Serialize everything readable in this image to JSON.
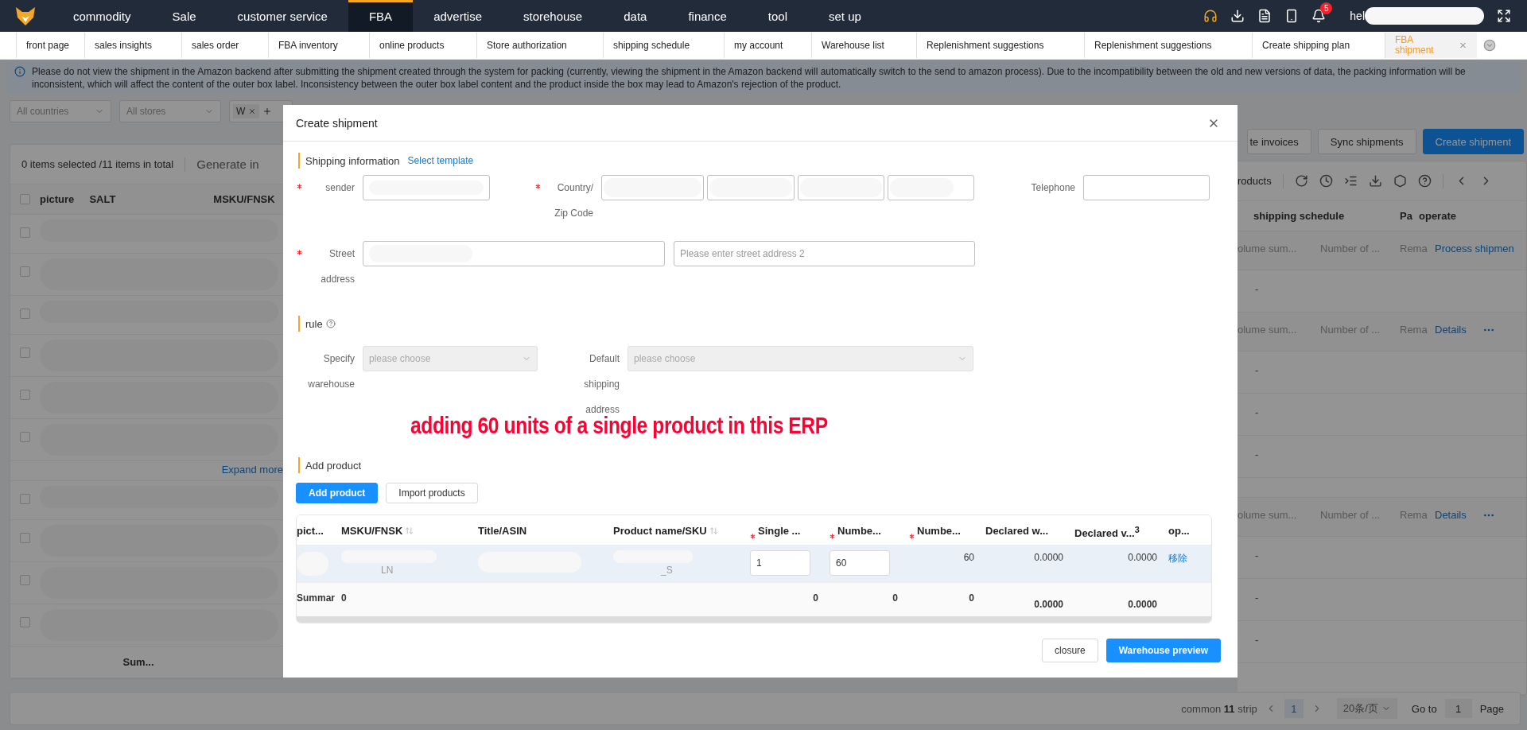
{
  "nav": {
    "menu": [
      {
        "label": "commodity",
        "selected": false
      },
      {
        "label": "Sale",
        "selected": false
      },
      {
        "label": "customer service",
        "selected": false
      },
      {
        "label": "FBA",
        "selected": true
      },
      {
        "label": "advertise",
        "selected": false
      },
      {
        "label": "storehouse",
        "selected": false
      },
      {
        "label": "data",
        "selected": false
      },
      {
        "label": "finance",
        "selected": false
      },
      {
        "label": "tool",
        "selected": false
      },
      {
        "label": "set up",
        "selected": false
      }
    ],
    "notifications": "5",
    "user": "hel"
  },
  "tabs": [
    {
      "label": "front page",
      "selected": false
    },
    {
      "label": "sales insights",
      "selected": false
    },
    {
      "label": "sales order",
      "selected": false
    },
    {
      "label": "FBA inventory",
      "selected": false
    },
    {
      "label": "online products",
      "selected": false
    },
    {
      "label": "Store authorization",
      "selected": false
    },
    {
      "label": "shipping schedule",
      "selected": false
    },
    {
      "label": "my account",
      "selected": false
    },
    {
      "label": "Warehouse list",
      "selected": false
    },
    {
      "label": "Replenishment suggestions",
      "selected": false
    },
    {
      "label": "Replenishment suggestions",
      "selected": false
    },
    {
      "label": "Create shipping plan",
      "selected": false
    },
    {
      "label": "FBA shipment",
      "selected": true
    }
  ],
  "notice": "Please do not view the shipment in the Amazon backend after submitting the shipment created through the system for packing (currently, viewing the shipment in the Amazon backend will automatically switch to the send to amazon process). Due to the incompatibility between the old and new versions of data, the packing information will be inconsistent, which will affect the content of the outer box label. Inconsistency between the outer box label content and the product inside the box may lead to Amazon's rejection of the product.",
  "filters": {
    "country": "All countries",
    "store": "All stores",
    "tag": "W"
  },
  "actions": [
    {
      "label": "te invoices",
      "kind": "default"
    },
    {
      "label": "Sync shipments",
      "kind": "default"
    },
    {
      "label": "Create shipment",
      "kind": "primary"
    }
  ],
  "list": {
    "all_checked": false,
    "selection": "0 items selected /11 items in total",
    "generate": "Generate in",
    "products": "roducts",
    "columns_left": [
      "picture",
      "SALT",
      "MSKU/FNSK"
    ],
    "columns_right": [
      "shipping schedule",
      "Pa",
      "operate"
    ],
    "rows": [
      {
        "kind": "parent",
        "checked": false,
        "volume": "olume sum...",
        "count": "Number of ...",
        "remark": "Rema",
        "action": "Process shipmen",
        "more": false
      },
      {
        "kind": "child",
        "checked": false,
        "value": "-"
      },
      {
        "kind": "parent",
        "checked": false,
        "volume": "olume sum...",
        "count": "Number of ...",
        "remark": "Rema",
        "action": "Details",
        "more": true
      },
      {
        "kind": "child",
        "checked": false,
        "value": "-"
      },
      {
        "kind": "child",
        "checked": false,
        "value": "-"
      },
      {
        "kind": "child",
        "checked": false,
        "value": "-"
      },
      {
        "kind": "expand",
        "label": "Expand more"
      },
      {
        "kind": "parent",
        "checked": false,
        "volume": "olume sum...",
        "count": "Number of ...",
        "remark": "Rema",
        "action": "Details",
        "more": true
      },
      {
        "kind": "child",
        "checked": false,
        "value": "-"
      },
      {
        "kind": "child",
        "checked": false,
        "value": "-"
      },
      {
        "kind": "child",
        "checked": false,
        "value": "-"
      },
      {
        "kind": "summary",
        "label": "Sum..."
      }
    ]
  },
  "pagination": {
    "total_prefix": "common",
    "total": "11",
    "total_suffix": "strip",
    "page": "1",
    "page_size": "20条/页",
    "goto_label": "Go to",
    "goto_value": "1",
    "page_label": "Page"
  },
  "modal": {
    "title": "Create shipment",
    "shipping": {
      "heading": "Shipping information",
      "template_link": "Select template",
      "sender": {
        "label": "sender",
        "required": true
      },
      "country": {
        "label": "Country/ Zip Code",
        "required": true
      },
      "telephone": {
        "label": "Telephone",
        "required": false
      },
      "street": {
        "label": "Street address",
        "required": true,
        "placeholder2": "Please enter street address 2"
      }
    },
    "rule": {
      "heading": "rule",
      "warehouse": {
        "label": "Specify warehouse",
        "placeholder": "please choose",
        "disabled": true
      },
      "address": {
        "label": "Default shipping address",
        "placeholder": "please choose",
        "disabled": true
      }
    },
    "annotation": "adding 60 units of a single product in this ERP",
    "products": {
      "heading": "Add product",
      "buttons": [
        {
          "label": "Add product",
          "kind": "primary"
        },
        {
          "label": "Import products",
          "kind": "default"
        }
      ],
      "columns": [
        {
          "label": "pict...",
          "required": false,
          "sortable": false
        },
        {
          "label": "MSKU/FNSK",
          "required": false,
          "sortable": true
        },
        {
          "label": "Title/ASIN",
          "required": false,
          "sortable": false
        },
        {
          "label": "Product name/SKU",
          "required": false,
          "sortable": true
        },
        {
          "label": "Single ...",
          "required": true,
          "sortable": false
        },
        {
          "label": "Numbe...",
          "required": true,
          "sortable": false
        },
        {
          "label": "Numbe...",
          "required": true,
          "sortable": false
        },
        {
          "label": "Declared w...",
          "required": false,
          "sortable": false
        },
        {
          "label": "Declared v...$^{3}$",
          "required": false,
          "sortable": false
        },
        {
          "label": "op...",
          "required": false,
          "sortable": false
        }
      ],
      "row": {
        "msku": "LN",
        "sku": "_S",
        "single": "1",
        "number": "60",
        "number_total": "60",
        "weight": "0.0000",
        "value": "0.0000",
        "action": "移除"
      },
      "summary": {
        "label": "Summar",
        "msku": "0",
        "single": "0",
        "number": "0",
        "number_total": "0",
        "weight": "0.0000",
        "value": "0.0000"
      }
    },
    "footer": [
      {
        "label": "closure",
        "kind": "default"
      },
      {
        "label": "Warehouse preview",
        "kind": "primary"
      }
    ]
  }
}
